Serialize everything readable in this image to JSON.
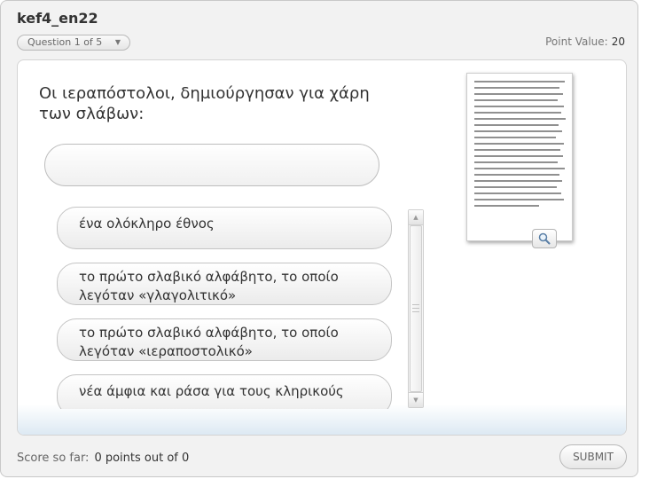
{
  "quiz": {
    "title": "kef4_en22"
  },
  "header": {
    "question_selector": "Question 1 of 5",
    "point_value_label": "Point Value:",
    "point_value": "20"
  },
  "question": {
    "text": "Οι ιεραπόστολοι, δημιούργησαν για χάρη των σλάβων:",
    "answer_value": ""
  },
  "options": [
    {
      "label": "ένα ολόκληρο έθνος"
    },
    {
      "label": "το πρώτο σλαβικό αλφάβητο, το οποίο λεγόταν «γλαγολιτικό»"
    },
    {
      "label": "το πρώτο σλαβικό αλφάβητο, το οποίο λεγόταν «ιεραποστολικό»"
    },
    {
      "label": "νέα άμφια και ράσα για τους κληρικούς"
    }
  ],
  "media": {
    "image": "manuscript-page",
    "zoom_icon": "magnifier-icon"
  },
  "footer": {
    "score_label": "Score so far:",
    "score_value": "0 points out of 0",
    "submit_label": "SUBMIT"
  },
  "colors": {
    "frame_bg": "#f2f2f2",
    "card_bg": "#ffffff",
    "text": "#333333",
    "muted": "#777777",
    "bottom_tint": "#dde9f3"
  }
}
